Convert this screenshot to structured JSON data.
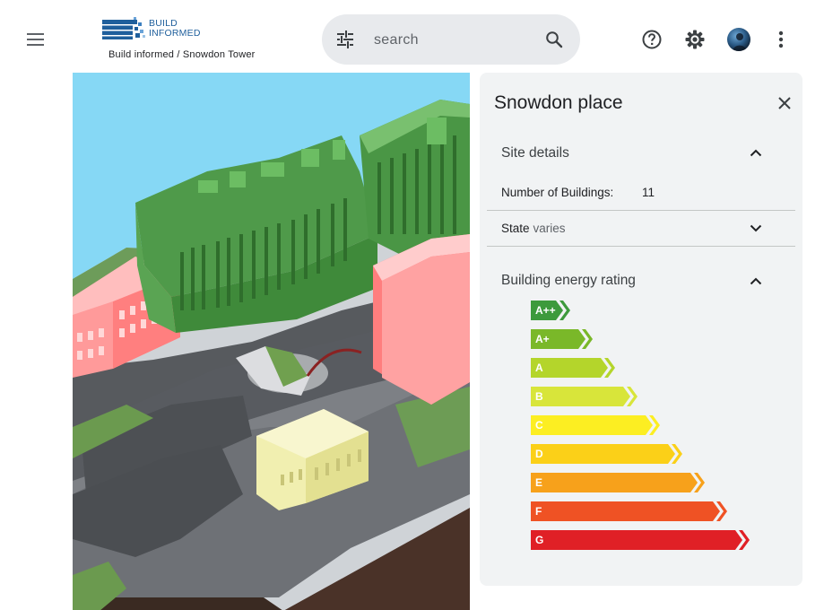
{
  "header": {
    "logo_text_line1": "BUILD",
    "logo_text_line2": "INFORMED",
    "breadcrumb": "Build informed / Snowdon Tower",
    "search_placeholder": "search",
    "icons": [
      "menu-icon",
      "tune-icon",
      "search-icon",
      "help-icon",
      "settings-icon",
      "avatar",
      "more-vert-icon"
    ]
  },
  "panel": {
    "title": "Snowdon place",
    "site_details": {
      "title": "Site details",
      "num_buildings_label": "Number of Buildings:",
      "num_buildings_value": "11",
      "state_label": "State",
      "state_value": "varies"
    },
    "energy": {
      "title": "Building energy rating",
      "ratings": [
        {
          "label": "A++",
          "color": "#3d9a3c"
        },
        {
          "label": "A+",
          "color": "#7ab829"
        },
        {
          "label": "A",
          "color": "#b4d52b"
        },
        {
          "label": "B",
          "color": "#d8e53a"
        },
        {
          "label": "C",
          "color": "#fcee22"
        },
        {
          "label": "D",
          "color": "#fbd018"
        },
        {
          "label": "E",
          "color": "#f7a11b"
        },
        {
          "label": "F",
          "color": "#ef5224"
        },
        {
          "label": "G",
          "color": "#e02026"
        }
      ]
    }
  },
  "colors": {
    "panel_bg": "#f1f3f4",
    "searchbar_bg": "#e8eaed",
    "logo_blue": "#1f5f9c",
    "building_green": "#4caf50",
    "building_red": "#ff8a8a",
    "building_yellow": "#f3f1a8"
  }
}
